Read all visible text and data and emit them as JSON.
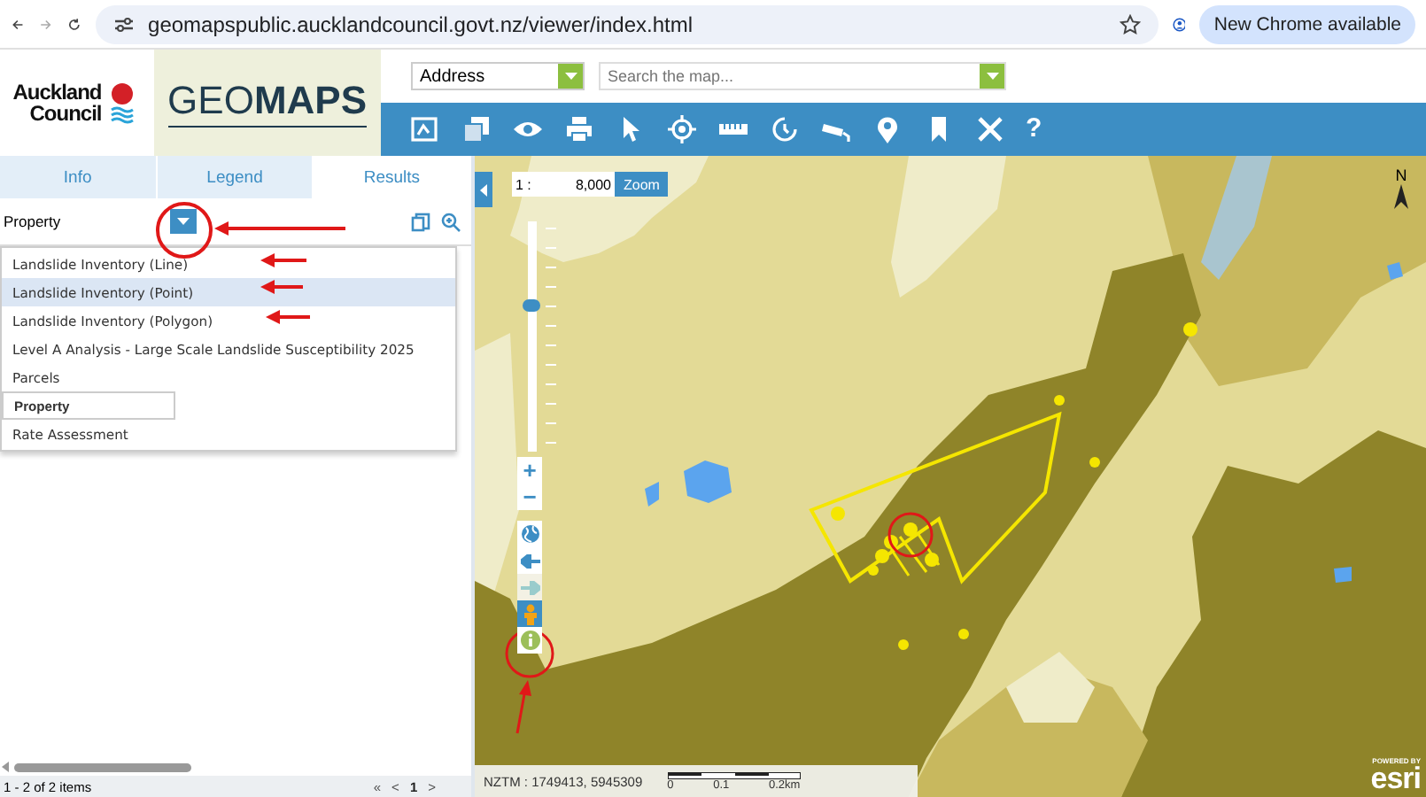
{
  "browser": {
    "url": "geomapspublic.aucklandcouncil.govt.nz/viewer/index.html",
    "update_button": "New Chrome available"
  },
  "header": {
    "logo_lines": [
      "Auckland",
      "Council"
    ],
    "app_title": "GEO**MAPS**",
    "address_select": "Address",
    "search": {
      "placeholder": "Search the map..."
    }
  },
  "toolbar": {
    "help_label": "?"
  },
  "panel": {
    "tabs": [
      {
        "label": "Info",
        "selected": false
      },
      {
        "label": "Legend",
        "selected": false
      },
      {
        "label": "Results",
        "selected": true
      }
    ],
    "layer_select": {
      "value": "Property",
      "expanded": true
    },
    "layer_options": [
      {
        "label": "Landslide Inventory (Line)",
        "selected": false,
        "highlighted": false
      },
      {
        "label": "Landslide Inventory (Point)",
        "selected": false,
        "highlighted": true
      },
      {
        "label": "Landslide Inventory (Polygon)",
        "selected": false,
        "highlighted": false
      },
      {
        "label": "Level A Analysis - Large Scale Landslide Susceptibility 2025",
        "selected": false,
        "highlighted": false
      },
      {
        "label": "Parcels",
        "selected": false,
        "highlighted": false
      },
      {
        "label": "Property",
        "selected": true,
        "highlighted": false
      },
      {
        "label": "Rate Assessment",
        "selected": false,
        "highlighted": false
      }
    ],
    "footer": {
      "count": "1 - 2 of 2 items",
      "pager": [
        "«",
        "<",
        "1",
        ">"
      ]
    }
  },
  "map": {
    "scale": {
      "prefix": "1 :",
      "value": "8,000",
      "button": "Zoom"
    },
    "zoom_slider": {
      "level": 0.64
    },
    "zoom_buttons": [
      "+",
      "−"
    ],
    "north_label": "N",
    "coordinates": "NZTM : 1749413, 5945309",
    "scale_bar": [
      "0",
      "0.1",
      "0.2km"
    ],
    "attribution": {
      "small": "POWERED BY",
      "logo": "esri"
    }
  }
}
